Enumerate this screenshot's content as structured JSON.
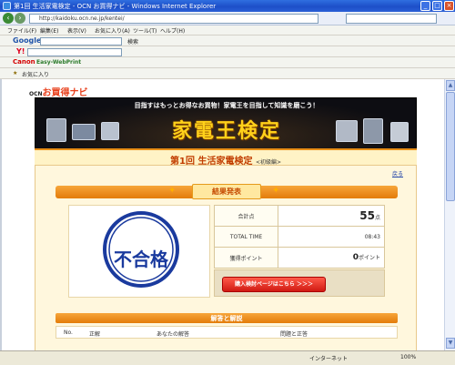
{
  "window": {
    "title": "第1回 生活家電検定 - OCN お買得ナビ - Windows Internet Explorer"
  },
  "address": {
    "url": "http://kaidoku.ocn.ne.jp/kentei/"
  },
  "menubar": {
    "items": [
      "ファイル(F)",
      "編集(E)",
      "表示(V)",
      "お気に入り(A)",
      "ツール(T)",
      "ヘルプ(H)"
    ]
  },
  "googlebar": {
    "logo": "Google",
    "go": "検索"
  },
  "yahoobar": {
    "logo": "Y!"
  },
  "canonbar": {
    "logo": "Canon",
    "easyweb": "Easy-WebPrint"
  },
  "favbar": {
    "label": "お気に入り"
  },
  "page": {
    "logo_ocn": "OCN",
    "logo_main": "お買得ナビ",
    "banner_tagline": "目指すはもっとお得なお買物！家電王を目指して知識を磨こう！",
    "banner_title": "家電王検定",
    "quiz_title": "第1回 生活家電検定",
    "quiz_level": "<初級編>",
    "back_link": "戻る",
    "results_title": "結果発表",
    "stamp_text": "不合格",
    "score": {
      "score_label": "合計点",
      "score_value": "55",
      "score_unit": "点",
      "time_label": "TOTAL TIME",
      "time_value": "08:43",
      "points_label": "獲得ポイント",
      "points_value": "0",
      "points_unit": "ポイント"
    },
    "buy_button": "購入検討ページはこちら ＞＞＞",
    "answers_title": "解答と解説",
    "answer_columns": [
      "No.",
      "正解",
      "あなたの解答",
      "問題と正答"
    ]
  },
  "status": {
    "zone": "インターネット",
    "zoom": "100%"
  },
  "colors": {
    "accent_orange": "#e37c0a",
    "stamp_blue": "#1a3a9e",
    "buy_red": "#d01a12"
  }
}
